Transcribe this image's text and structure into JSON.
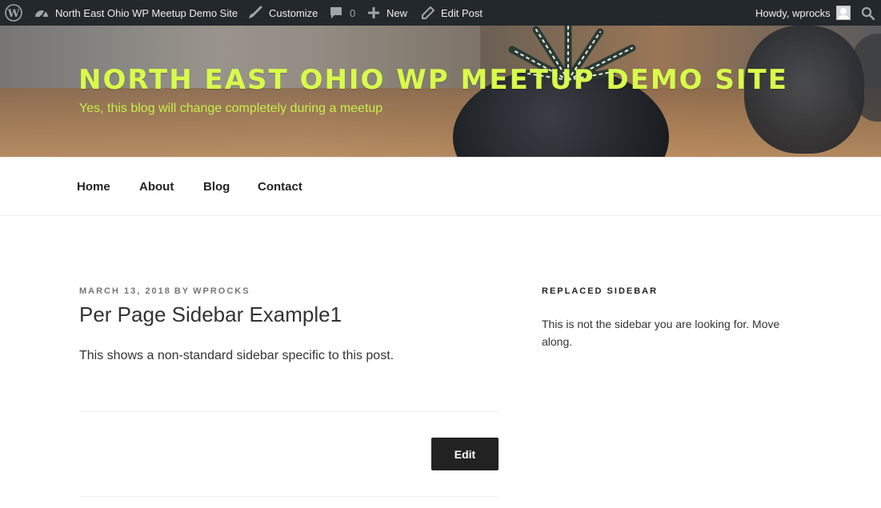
{
  "adminbar": {
    "site_name": "North East Ohio WP Meetup Demo Site",
    "customize": "Customize",
    "comments_count": "0",
    "new": "New",
    "edit_post": "Edit Post",
    "howdy": "Howdy, wprocks"
  },
  "header": {
    "site_title": "NORTH EAST OHIO WP MEETUP DEMO SITE",
    "tagline": "Yes, this blog will change completely during a meetup",
    "title_color": "#d8fb4b"
  },
  "nav": {
    "items": [
      {
        "label": "Home"
      },
      {
        "label": "About"
      },
      {
        "label": "Blog"
      },
      {
        "label": "Contact"
      }
    ]
  },
  "post": {
    "date": "MARCH 13, 2018",
    "by": "BY",
    "author": "WPROCKS",
    "title": "Per Page Sidebar Example1",
    "body": "This shows a non-standard sidebar specific to this post.",
    "edit_label": "Edit"
  },
  "sidebar": {
    "widget_title": "REPLACED SIDEBAR",
    "widget_text": "This is not the sidebar you are looking for. Move along."
  },
  "icons": {
    "wordpress": "wordpress-logo-icon",
    "dashboard": "dashboard-icon",
    "customize": "paintbrush-icon",
    "comments": "comment-icon",
    "new": "plus-icon",
    "edit": "pencil-icon",
    "search": "search-icon"
  },
  "colors": {
    "adminbar_bg": "#23282d",
    "button_bg": "#222222"
  }
}
